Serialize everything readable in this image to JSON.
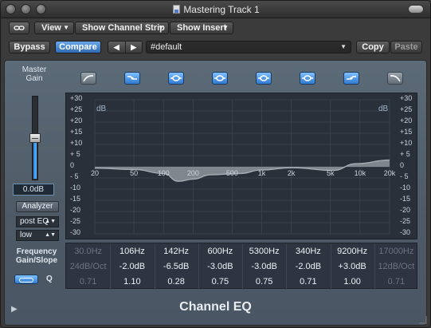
{
  "window": {
    "title": "Mastering Track 1"
  },
  "toolbar": {
    "link_icon": "link-icon",
    "view_label": "View",
    "channel_strip_label": "Show Channel Strip",
    "insert_label": "Show Insert",
    "bypass_label": "Bypass",
    "compare_label": "Compare",
    "prev_label": "◀",
    "next_label": "▶",
    "preset_value": "#default",
    "copy_label": "Copy",
    "paste_label": "Paste",
    "dropdown_arrow": "▼"
  },
  "left_panel": {
    "master_gain_label": "Master\nGain",
    "gain_value": "0.0dB",
    "fader_level_db": 0.0,
    "analyzer_label": "Analyzer",
    "analyzer_mode": "post EQ",
    "analyzer_resolution": "low"
  },
  "band_buttons": [
    {
      "type": "highpass",
      "active": false,
      "icon": "highpass-icon"
    },
    {
      "type": "lowshelf",
      "active": true,
      "icon": "low-shelf-icon"
    },
    {
      "type": "bell",
      "active": true,
      "icon": "bell-icon"
    },
    {
      "type": "bell",
      "active": true,
      "icon": "bell-icon"
    },
    {
      "type": "bell",
      "active": true,
      "icon": "bell-icon"
    },
    {
      "type": "bell",
      "active": true,
      "icon": "bell-icon"
    },
    {
      "type": "highshelf",
      "active": true,
      "icon": "high-shelf-icon"
    },
    {
      "type": "lowpass",
      "active": false,
      "icon": "lowpass-icon"
    }
  ],
  "graph": {
    "unit_label_left": "dB",
    "unit_label_right": "dB",
    "db_ticks": [
      "+30",
      "+25",
      "+20",
      "+15",
      "+10",
      "+ 5",
      "0",
      "- 5",
      "-10",
      "-15",
      "-20",
      "-25",
      "-30"
    ],
    "freq_ticks": [
      "20",
      "50",
      "100",
      "200",
      "500",
      "1k",
      "2k",
      "5k",
      "10k",
      "20k"
    ],
    "curve_color": "#a7adb4",
    "grid_color": "#3f4753",
    "curve_db": [
      {
        "f": 20,
        "db": -0.6
      },
      {
        "f": 50,
        "db": -1.2
      },
      {
        "f": 100,
        "db": -3.0
      },
      {
        "f": 142,
        "db": -6.5
      },
      {
        "f": 200,
        "db": -5.5
      },
      {
        "f": 300,
        "db": -3.6
      },
      {
        "f": 600,
        "db": -3.0
      },
      {
        "f": 1000,
        "db": -1.4
      },
      {
        "f": 2000,
        "db": -0.4
      },
      {
        "f": 5300,
        "db": -1.6
      },
      {
        "f": 9200,
        "db": 1.4
      },
      {
        "f": 20000,
        "db": 3.0
      }
    ]
  },
  "params": {
    "frequency_label": "Frequency",
    "gain_slope_label": "Gain/Slope",
    "q_label": "Q",
    "bands": [
      {
        "freq": "30.0Hz",
        "gain": "24dB/Oct",
        "q": "0.71",
        "active": false
      },
      {
        "freq": "106Hz",
        "gain": "-2.0dB",
        "q": "1.10",
        "active": true
      },
      {
        "freq": "142Hz",
        "gain": "-6.5dB",
        "q": "0.28",
        "active": true
      },
      {
        "freq": "600Hz",
        "gain": "-3.0dB",
        "q": "0.75",
        "active": true
      },
      {
        "freq": "5300Hz",
        "gain": "-3.0dB",
        "q": "0.75",
        "active": true
      },
      {
        "freq": "340Hz",
        "gain": "-2.0dB",
        "q": "0.71",
        "active": true
      },
      {
        "freq": "9200Hz",
        "gain": "+3.0dB",
        "q": "1.00",
        "active": true
      },
      {
        "freq": "17000Hz",
        "gain": "12dB/Oct",
        "q": "0.71",
        "active": false
      }
    ]
  },
  "footer": {
    "plugin_name": "Channel EQ",
    "disclosure_icon": "disclosure-triangle-icon"
  },
  "colors": {
    "accent_blue": "#3f8be0",
    "panel": "#56636f"
  }
}
